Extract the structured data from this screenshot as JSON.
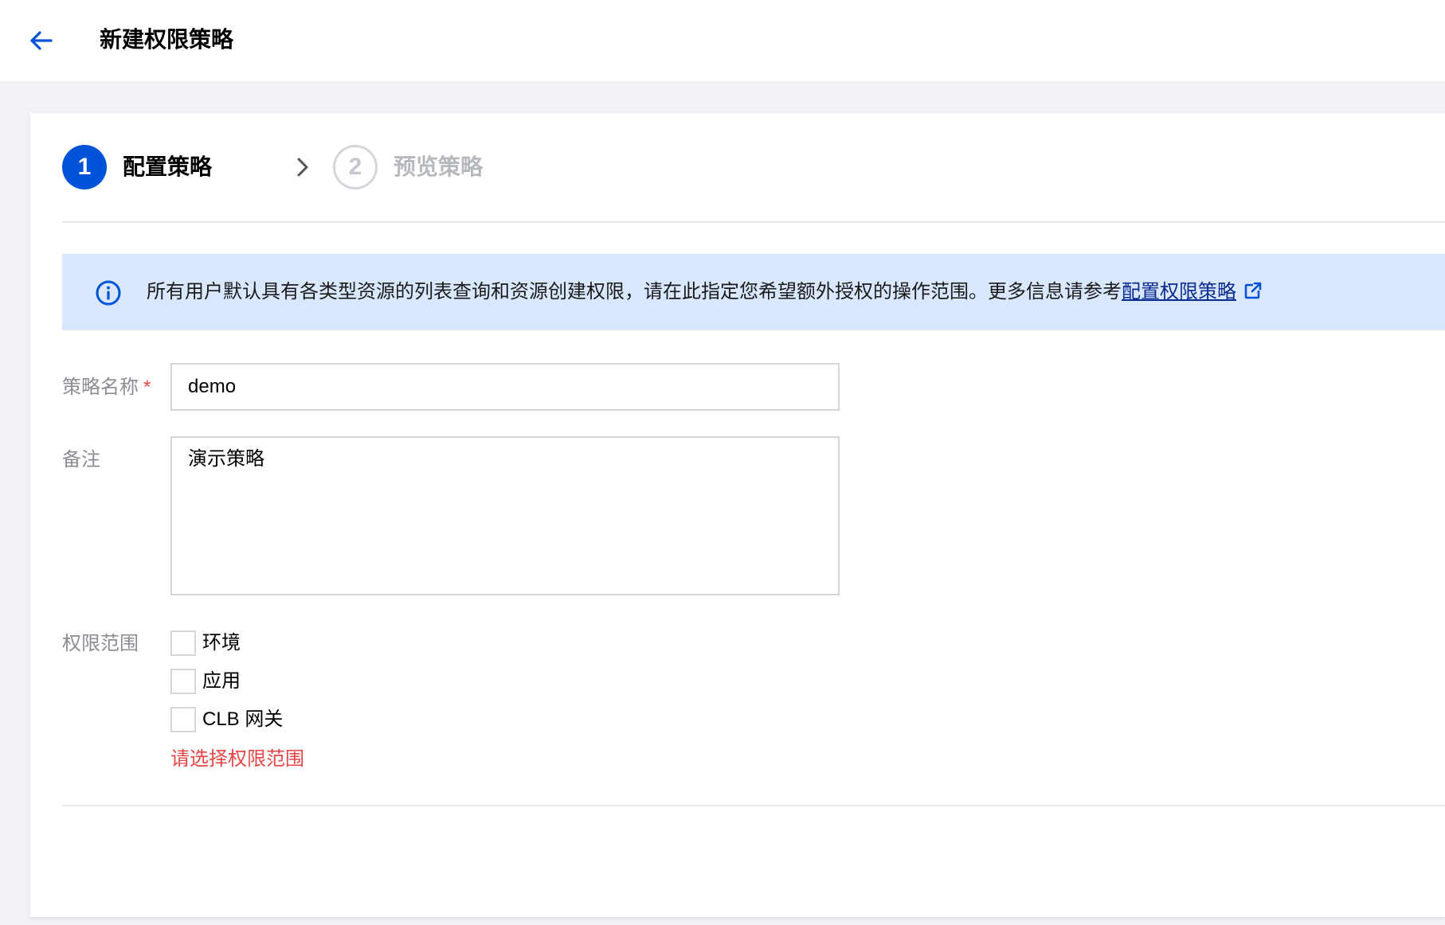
{
  "header": {
    "back_icon": "arrow-left-icon",
    "title": "新建权限策略",
    "accent_color": "#0052d9"
  },
  "steps": [
    {
      "number": "1",
      "label": "配置策略",
      "state": "active"
    },
    {
      "number": "2",
      "label": "预览策略",
      "state": "inactive"
    }
  ],
  "step_separator_icon": "chevron-right-icon",
  "info_banner": {
    "icon": "info-circle-icon",
    "text": "所有用户默认具有各类型资源的列表查询和资源创建权限，请在此指定您希望额外授权的操作范围。更多信息请参考",
    "link_text": "配置权限策略",
    "link_icon": "external-link-icon",
    "background_color": "#d9e8ff"
  },
  "form": {
    "name": {
      "label": "策略名称",
      "required_mark": "*",
      "value": "demo"
    },
    "remark": {
      "label": "备注",
      "value": "演示策略"
    },
    "scope": {
      "label": "权限范围",
      "options": [
        {
          "label": "环境",
          "checked": false
        },
        {
          "label": "应用",
          "checked": false
        },
        {
          "label": "CLB 网关",
          "checked": false
        }
      ],
      "error": "请选择权限范围",
      "error_color": "#e54545"
    }
  }
}
